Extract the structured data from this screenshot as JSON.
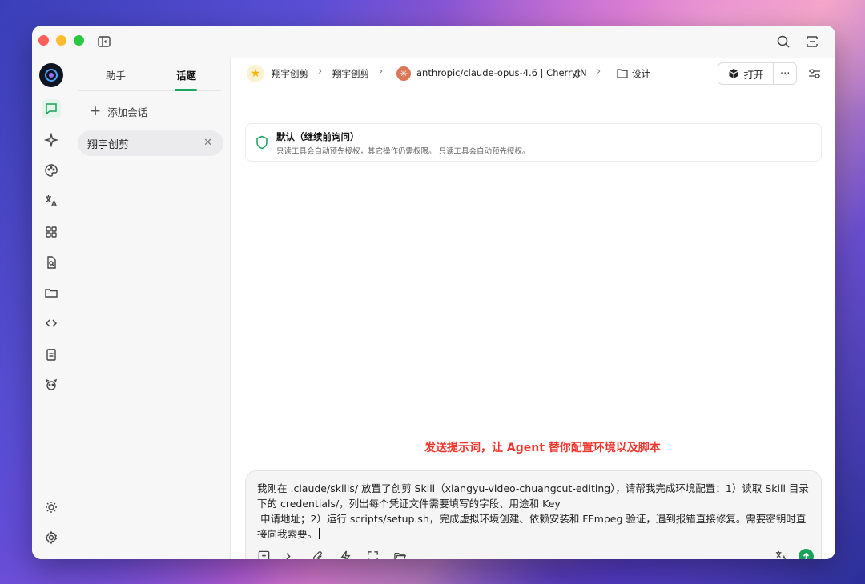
{
  "window": {
    "title_bar": {
      "traffic_lights": [
        "close",
        "minimize",
        "zoom"
      ],
      "icons": [
        "sidebar-toggle-icon",
        "search-icon",
        "layout-icon"
      ]
    }
  },
  "iconbar": {
    "items": [
      {
        "name": "chat-icon",
        "active": true
      },
      {
        "name": "sparkle-icon",
        "active": false
      },
      {
        "name": "palette-icon",
        "active": false
      },
      {
        "name": "translate-icon",
        "active": false
      },
      {
        "name": "apps-grid-icon",
        "active": false
      },
      {
        "name": "file-search-icon",
        "active": false
      },
      {
        "name": "folder-icon",
        "active": false
      },
      {
        "name": "code-icon",
        "active": false
      },
      {
        "name": "notes-icon",
        "active": false
      },
      {
        "name": "mascot-icon",
        "active": false
      }
    ],
    "bottom": [
      "theme-sun-icon",
      "settings-gear-icon"
    ]
  },
  "topic_pane": {
    "tabs": [
      {
        "label": "助手"
      },
      {
        "label": "话题"
      }
    ],
    "active_tab": 1,
    "add_label": "添加会话",
    "topics": [
      {
        "label": "翔宇创剪"
      }
    ]
  },
  "header": {
    "crumbs": [
      "翔宇创剪",
      "翔宇创剪"
    ],
    "model": "anthropic/claude-opus-4.6 | CherryIN",
    "folder": "设计",
    "open_label": "打开",
    "more_label": "···"
  },
  "permission": {
    "title": "默认（继续前询问）",
    "description": "只读工具会自动预先授权，其它操作仍需权限。 只读工具会自动预先授权。"
  },
  "annotation": "发送提示词，让 Agent 替你配置环境以及脚本",
  "composer": {
    "text": "我刚在 .claude/skills/ 放置了创剪 Skill（xiangyu-video-chuangcut-editing），请帮我完成环境配置：1）读取 Skill 目录下的 credentials/，列出每个凭证文件需要填写的字段、用途和 Key\n 申请地址；2）运行 scripts/setup.sh，完成虚拟环境创建、依赖安装和 FFmpeg 验证，遇到报错直接修复。需要密钥时直接向我索要。",
    "tools": [
      "new-topic-icon",
      "terminal-icon",
      "attach-icon",
      "lightning-icon",
      "fullscreen-icon",
      "folder-open-icon"
    ],
    "right_tools": [
      "translate-icon",
      "send-icon"
    ]
  },
  "colors": {
    "accent": "#17a35a",
    "annotation": "#f0372e",
    "model_icon": "#d97757"
  }
}
